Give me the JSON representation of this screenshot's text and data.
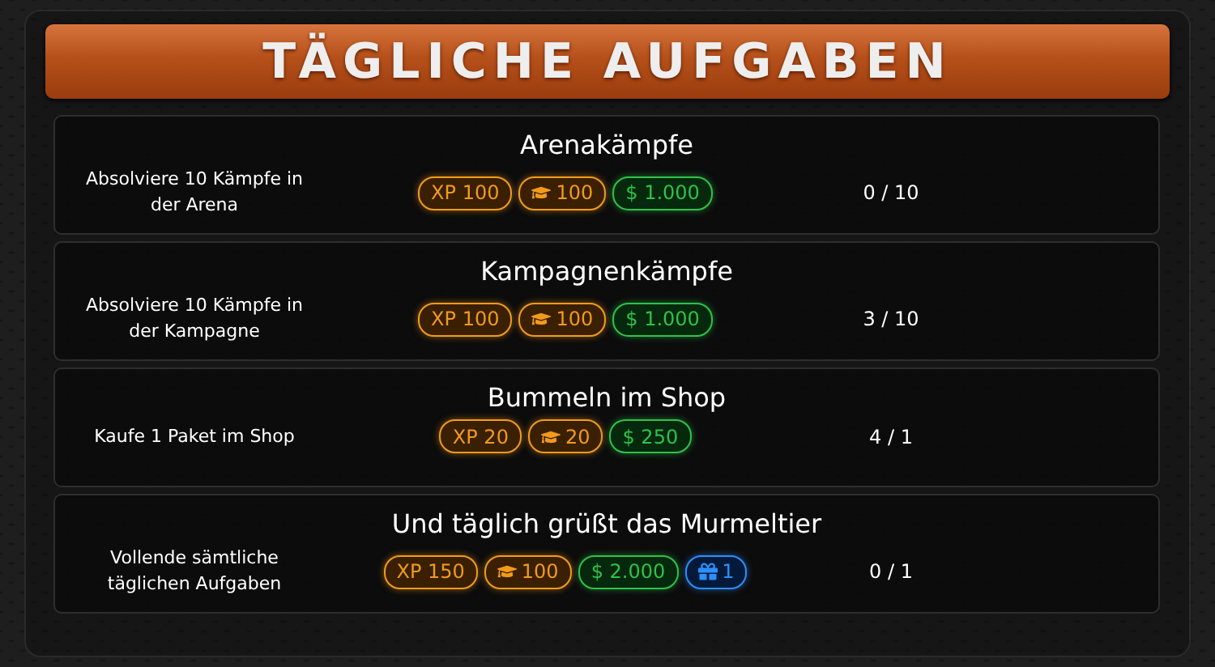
{
  "title": "TÄGLICHE AUFGABEN",
  "tasks": [
    {
      "name": "Arenakämpfe",
      "description": "Absolviere 10 Kämpfe in der Arena",
      "progress": "0 / 10",
      "rewards": [
        {
          "kind": "xp",
          "label": "XP 100"
        },
        {
          "kind": "skill",
          "label": "100"
        },
        {
          "kind": "cash",
          "label": "$ 1.000"
        }
      ]
    },
    {
      "name": "Kampagnenkämpfe",
      "description": "Absolviere 10 Kämpfe in der Kampagne",
      "progress": "3 / 10",
      "rewards": [
        {
          "kind": "xp",
          "label": "XP 100"
        },
        {
          "kind": "skill",
          "label": "100"
        },
        {
          "kind": "cash",
          "label": "$ 1.000"
        }
      ]
    },
    {
      "name": "Bummeln im Shop",
      "description": "Kaufe 1 Paket im Shop",
      "progress": "4 / 1",
      "rewards": [
        {
          "kind": "xp",
          "label": "XP 20"
        },
        {
          "kind": "skill",
          "label": "20"
        },
        {
          "kind": "cash",
          "label": "$ 250"
        }
      ]
    },
    {
      "name": "Und täglich grüßt das Murmeltier",
      "description": "Vollende sämtliche täglichen Aufgaben",
      "progress": "0 / 1",
      "rewards": [
        {
          "kind": "xp",
          "label": "XP 150"
        },
        {
          "kind": "skill",
          "label": "100"
        },
        {
          "kind": "cash",
          "label": "$ 2.000"
        },
        {
          "kind": "gift",
          "label": "1"
        }
      ]
    }
  ]
}
